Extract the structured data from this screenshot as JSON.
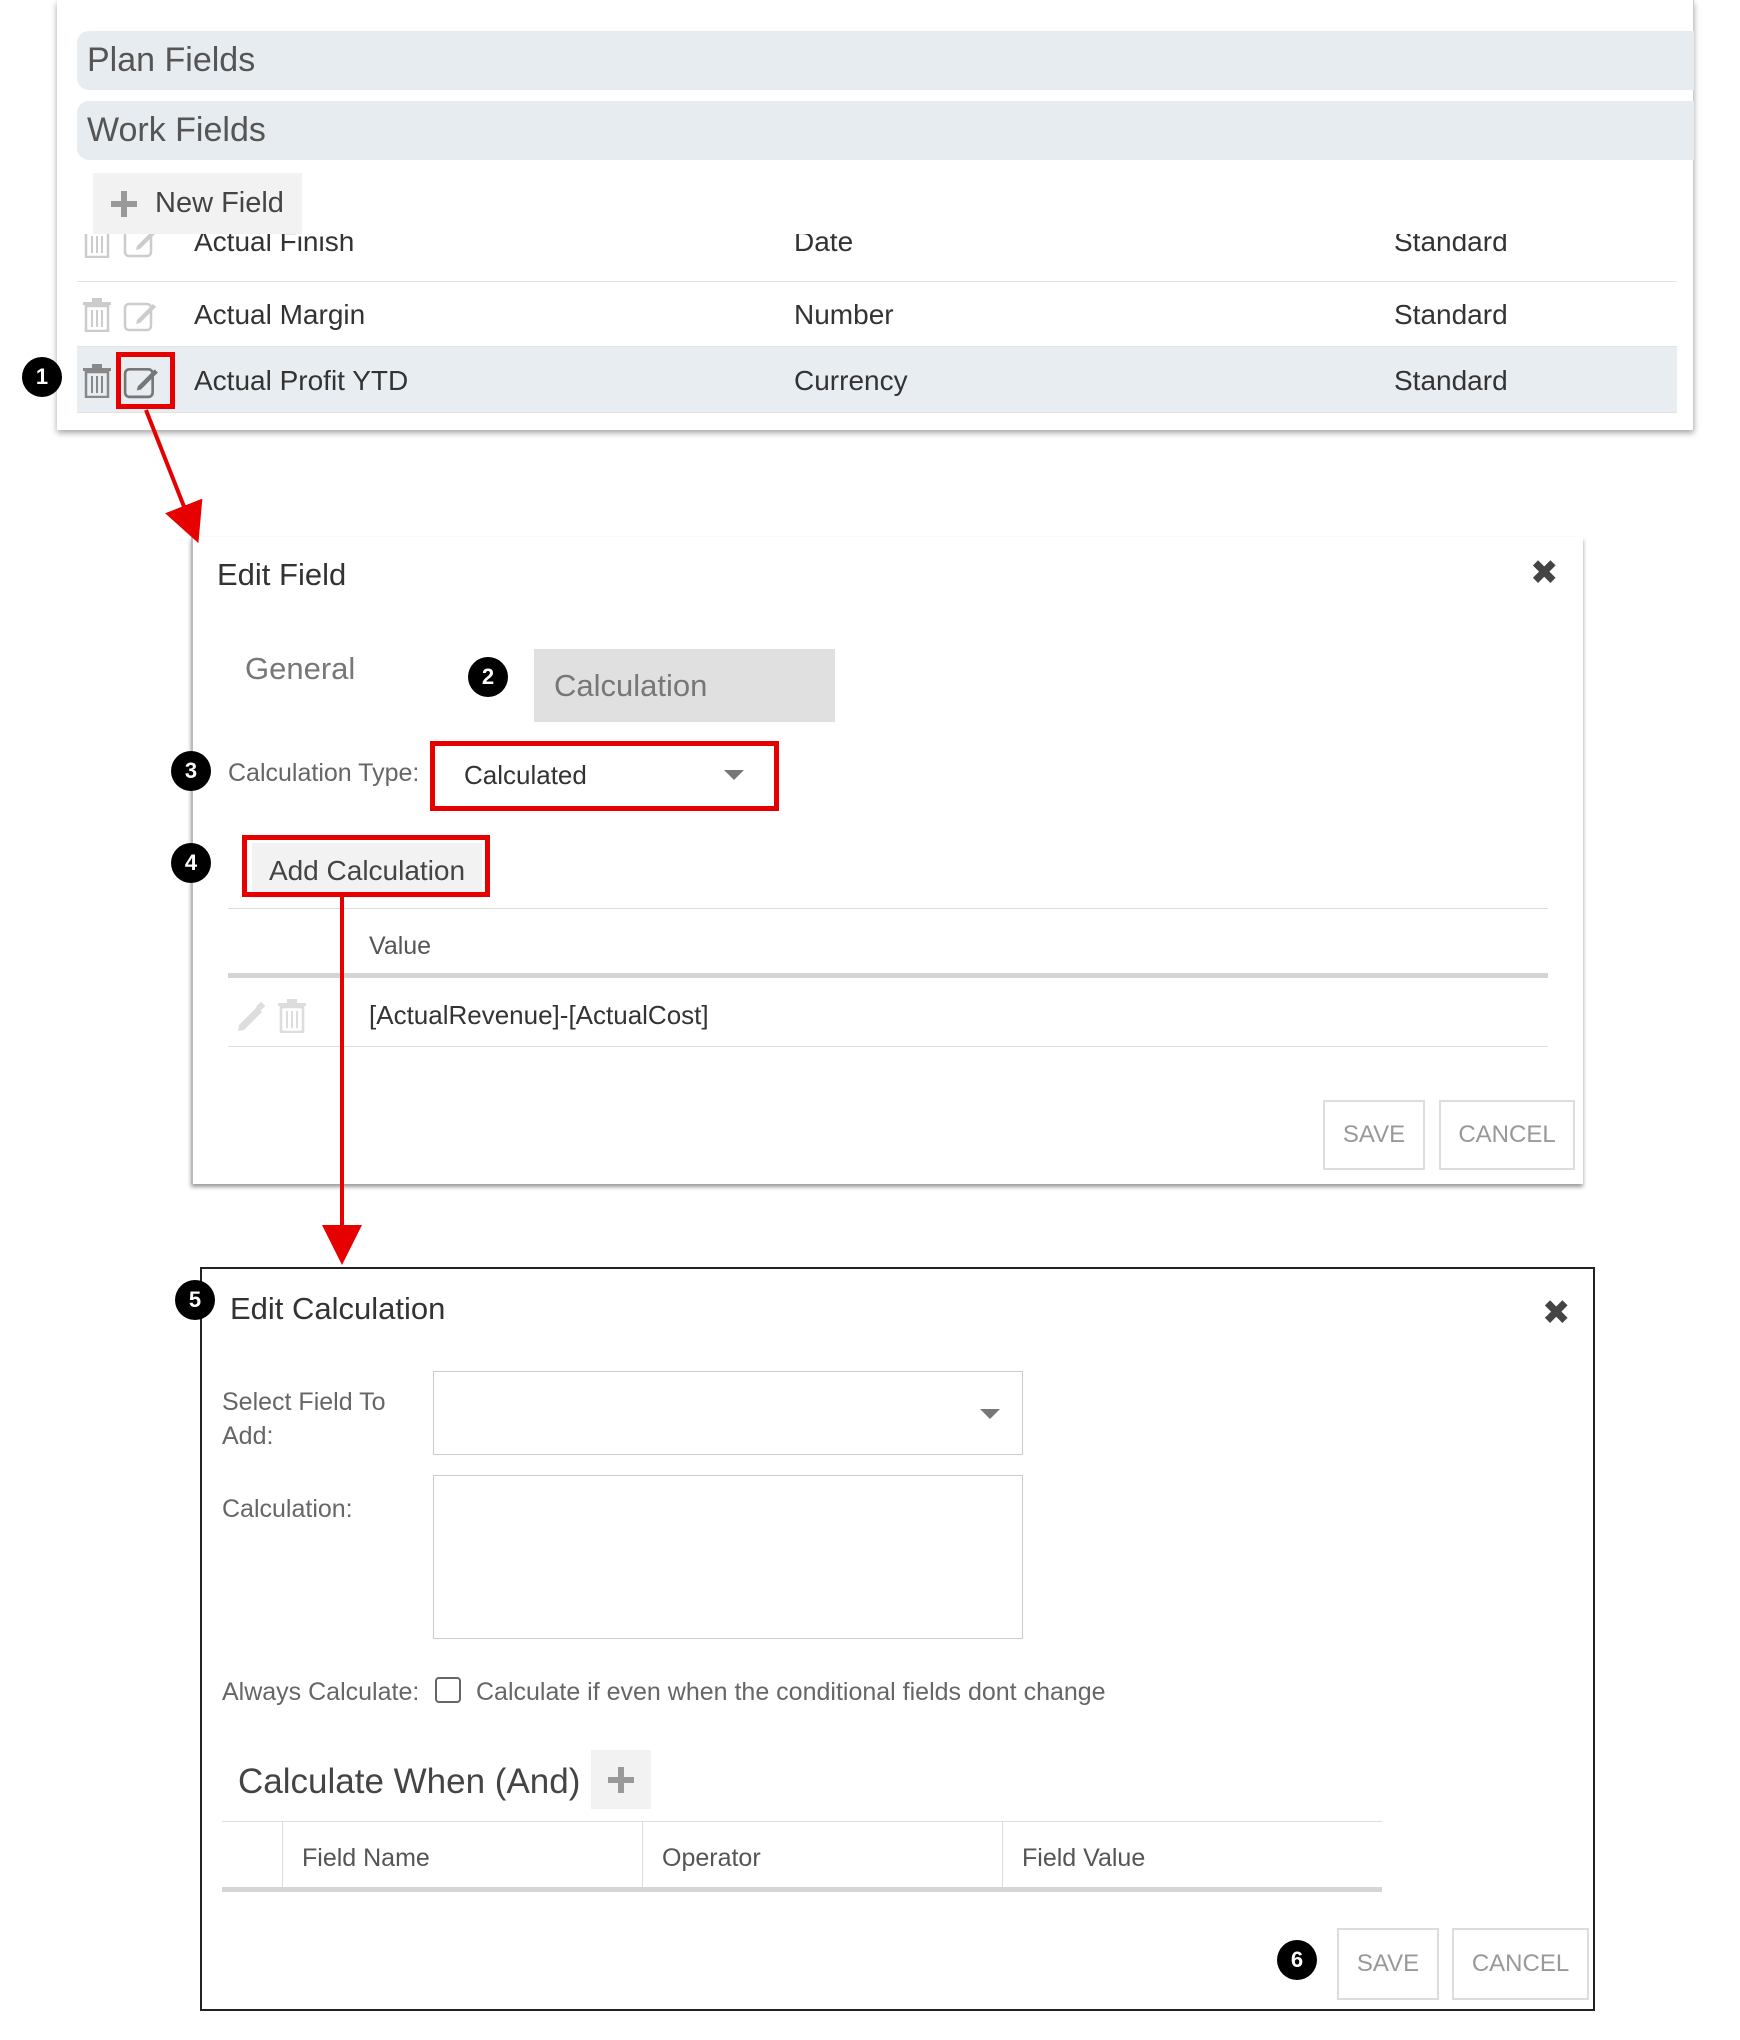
{
  "top": {
    "accordions": [
      "Plan Fields",
      "Work Fields"
    ],
    "new_field_label": "New Field",
    "rows": [
      {
        "name": "Actual Finish",
        "type": "Date",
        "category": "Standard"
      },
      {
        "name": "Actual Margin",
        "type": "Number",
        "category": "Standard"
      },
      {
        "name": "Actual Profit YTD",
        "type": "Currency",
        "category": "Standard"
      }
    ]
  },
  "badges": [
    "1",
    "2",
    "3",
    "4",
    "5",
    "6"
  ],
  "edit_field": {
    "title": "Edit Field",
    "close": "✖",
    "tabs": [
      "General",
      "Calculation"
    ],
    "calc_type_label": "Calculation Type:",
    "calc_type_value": "Calculated",
    "add_calc_label": "Add Calculation",
    "table_header": "Value",
    "table_row": "[ActualRevenue]-[ActualCost]",
    "save": "SAVE",
    "cancel": "CANCEL"
  },
  "edit_calc": {
    "title": "Edit Calculation",
    "close": "✖",
    "select_field_label_1": "Select Field To",
    "select_field_label_2": "Add:",
    "calculation_label": "Calculation:",
    "always_label": "Always Calculate:",
    "always_checkbox_text": "Calculate if even when the conditional fields dont change",
    "calc_when_title": "Calculate When (And)",
    "columns": [
      "Field Name",
      "Operator",
      "Field Value"
    ],
    "save": "SAVE",
    "cancel": "CANCEL"
  },
  "colors": {
    "highlight": "#e60000",
    "accordion_bg": "#e6ecef",
    "selected_row": "#e8edf1"
  }
}
